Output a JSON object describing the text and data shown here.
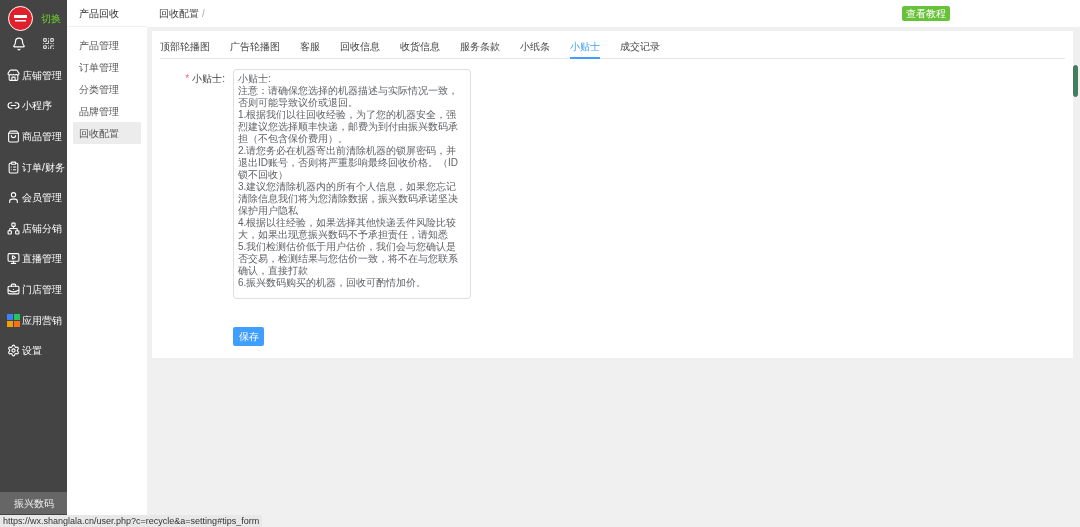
{
  "logo": {
    "switch_label": "切换"
  },
  "nav": [
    {
      "label": "店铺管理",
      "kind": "store"
    },
    {
      "label": "小程序",
      "kind": "link"
    },
    {
      "label": "商品管理",
      "kind": "goods"
    },
    {
      "label": "订单/财务",
      "kind": "order"
    },
    {
      "label": "会员管理",
      "kind": "user"
    },
    {
      "label": "店铺分销",
      "kind": "network"
    },
    {
      "label": "直播管理",
      "kind": "live"
    },
    {
      "label": "门店管理",
      "kind": "shop"
    },
    {
      "label": "应用营销",
      "kind": "apps"
    },
    {
      "label": "设置",
      "kind": "settings"
    }
  ],
  "nav_footer": "振兴数码",
  "subnav": {
    "title": "产品回收",
    "items": [
      {
        "label": "产品管理",
        "selected": false
      },
      {
        "label": "订单管理",
        "selected": false
      },
      {
        "label": "分类管理",
        "selected": false
      },
      {
        "label": "品牌管理",
        "selected": false
      },
      {
        "label": "回收配置",
        "selected": true
      }
    ]
  },
  "breadcrumb": [
    "回收配置",
    "/"
  ],
  "tutorial_button": "查看教程",
  "tabs": [
    {
      "label": "顶部轮播图",
      "selected": false
    },
    {
      "label": "广告轮播图",
      "selected": false
    },
    {
      "label": "客服",
      "selected": false
    },
    {
      "label": "回收信息",
      "selected": false
    },
    {
      "label": "收货信息",
      "selected": false
    },
    {
      "label": "服务条款",
      "selected": false
    },
    {
      "label": "小纸条",
      "selected": false
    },
    {
      "label": "小贴士",
      "selected": true
    },
    {
      "label": "成交记录",
      "selected": false
    }
  ],
  "form": {
    "required_mark": "*",
    "label": "小贴士:",
    "value": [
      "小贴士:",
      "注意：请确保您选择的机器描述与实际情况一致，否则可能导致议价或退回。",
      "1.根据我们以往回收经验，为了您的机器安全，强烈建议您选择顺丰快递，邮费为到付由振兴数码承担（不包含保价费用）。",
      "2.请您务必在机器寄出前清除机器的锁屏密码，并退出ID账号，否则将严重影响最终回收价格。（ID锁不回收）",
      "3.建议您清除机器内的所有个人信息，如果您忘记清除信息我们将为您清除数据，振兴数码承诺坚决保护用户隐私",
      "4.根据以往经验，如果选择其他快递丢件风险比较大，如果出现意振兴数码不予承担责任，请知悉",
      "5.我们检测估价低于用户估价，我们会与您确认是否交易，检测结果与您估价一致，将不在与您联系确认，直接打款",
      "6.振兴数码购买的机器，回收可酌情加价。"
    ],
    "save_button": "保存"
  },
  "status_url": "https://wx.shanglala.cn/user.php?c=recycle&a=setting#tips_form"
}
